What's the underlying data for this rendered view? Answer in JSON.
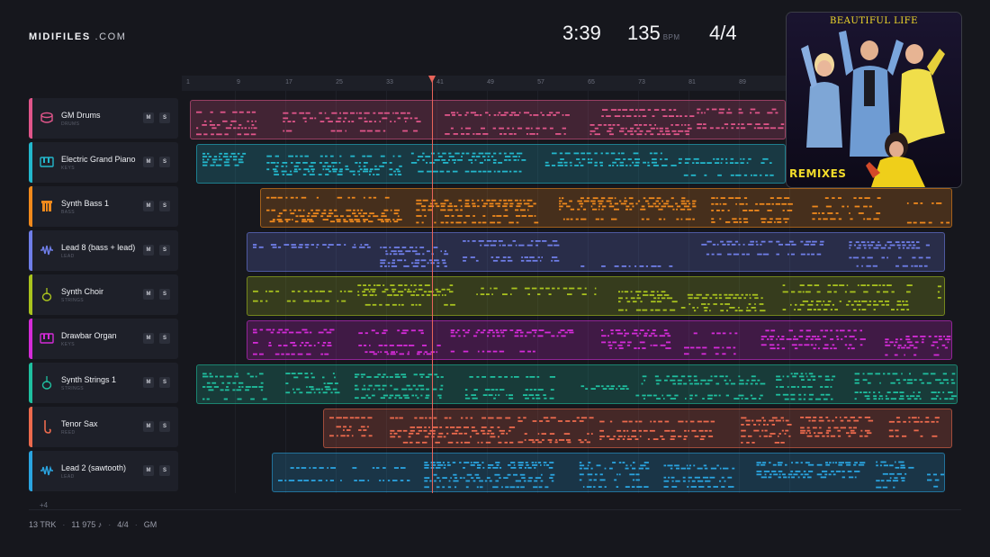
{
  "brand": {
    "name_bold": "MIDIFILES",
    "name_light": ".COM"
  },
  "header": {
    "duration": "3:39",
    "tempo": "135",
    "tempo_unit": "BPM",
    "time_signature": "4/4"
  },
  "album": {
    "title": "BEAUTIFUL LIFE",
    "subtitle": "REMIXES"
  },
  "ruler": {
    "ticks": [
      "1",
      "9",
      "17",
      "25",
      "33",
      "41",
      "49",
      "57",
      "65",
      "73",
      "81",
      "89"
    ]
  },
  "playhead": {
    "bar": 41
  },
  "tracks": [
    {
      "name": "GM Drums",
      "category": "DRUMS",
      "icon": "drum-icon",
      "color": "#e0558a",
      "mute": "M",
      "solo": "S"
    },
    {
      "name": "Electric Grand Piano",
      "category": "KEYS",
      "icon": "keyboard-icon",
      "color": "#23b7cc",
      "mute": "M",
      "solo": "S"
    },
    {
      "name": "Synth Bass 1",
      "category": "BASS",
      "icon": "bass-amp-icon",
      "color": "#f0891c",
      "mute": "M",
      "solo": "S"
    },
    {
      "name": "Lead 8 (bass + lead)",
      "category": "LEAD",
      "icon": "waveform-icon",
      "color": "#6f7ee8",
      "mute": "M",
      "solo": "S"
    },
    {
      "name": "Synth Choir",
      "category": "STRINGS",
      "icon": "violin-icon",
      "color": "#a9c21e",
      "mute": "M",
      "solo": "S"
    },
    {
      "name": "Drawbar Organ",
      "category": "KEYS",
      "icon": "keyboard-icon",
      "color": "#d42bd8",
      "mute": "M",
      "solo": "S"
    },
    {
      "name": "Synth Strings 1",
      "category": "STRINGS",
      "icon": "violin-icon",
      "color": "#1fbf9f",
      "mute": "M",
      "solo": "S"
    },
    {
      "name": "Tenor Sax",
      "category": "REED",
      "icon": "saxophone-icon",
      "color": "#ec6a4d",
      "mute": "M",
      "solo": "S"
    },
    {
      "name": "Lead 2 (sawtooth)",
      "category": "LEAD",
      "icon": "waveform-icon",
      "color": "#2aa4e0",
      "mute": "M",
      "solo": "S"
    }
  ],
  "more_tracks": "+4",
  "footer": {
    "tracks": "13 TRK",
    "notes": "11 975 ♪",
    "time_signature": "4/4",
    "standard": "GM"
  }
}
